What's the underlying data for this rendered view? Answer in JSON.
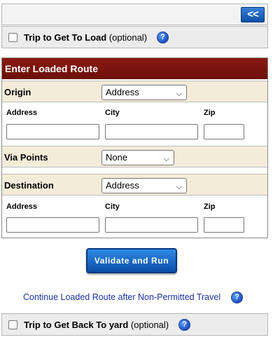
{
  "header": {
    "collapse_label": "<<"
  },
  "trip_to_load": {
    "label": "Trip to Get To Load",
    "optional": "(optional)",
    "help": "?"
  },
  "loaded_route": {
    "title": "Enter Loaded Route",
    "origin": {
      "label": "Origin",
      "type_selected": "Address",
      "address_label": "Address",
      "city_label": "City",
      "zip_label": "Zip",
      "address_value": "",
      "city_value": "",
      "zip_value": ""
    },
    "via_points": {
      "label": "Via Points",
      "selected": "None"
    },
    "destination": {
      "label": "Destination",
      "type_selected": "Address",
      "address_label": "Address",
      "city_label": "City",
      "zip_label": "Zip",
      "address_value": "",
      "city_value": "",
      "zip_value": ""
    }
  },
  "validate_button": "Validate and Run",
  "continue_link": "Continue Loaded Route after Non-Permitted Travel",
  "continue_help": "?",
  "trip_back_yard": {
    "label": "Trip to Get Back To yard",
    "optional": "(optional)",
    "help": "?"
  },
  "icons": {
    "dropdown": "chevron-down-icon",
    "help": "help-icon"
  }
}
